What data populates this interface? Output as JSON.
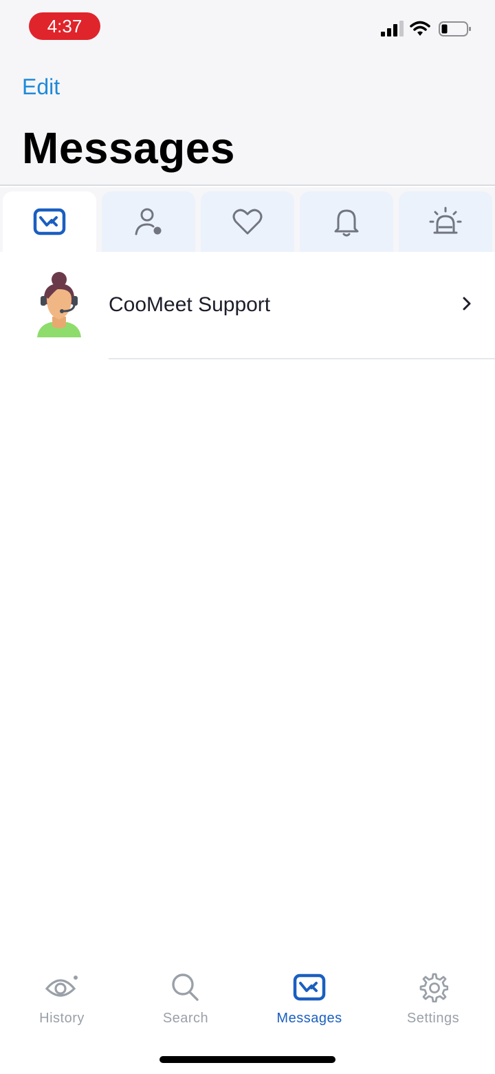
{
  "status_bar": {
    "time": "4:37",
    "icons": [
      "signal-icon",
      "wifi-icon",
      "battery-icon"
    ]
  },
  "header": {
    "edit_label": "Edit",
    "title": "Messages"
  },
  "category_tabs": [
    {
      "icon": "mail-icon",
      "active": true
    },
    {
      "icon": "person-icon",
      "active": false
    },
    {
      "icon": "heart-icon",
      "active": false
    },
    {
      "icon": "bell-icon",
      "active": false
    },
    {
      "icon": "siren-icon",
      "active": false
    }
  ],
  "messages": [
    {
      "name": "CooMeet Support",
      "avatar": "support-agent-avatar"
    }
  ],
  "tab_bar": {
    "items": [
      {
        "label": "History",
        "icon": "eye-icon",
        "active": false
      },
      {
        "label": "Search",
        "icon": "search-icon",
        "active": false
      },
      {
        "label": "Messages",
        "icon": "mail-icon",
        "active": true
      },
      {
        "label": "Settings",
        "icon": "gear-icon",
        "active": false
      }
    ]
  },
  "colors": {
    "accent": "#1a5fc0",
    "link": "#1f8ad9",
    "time_pill": "#e0242b",
    "inactive": "#9aa0a8",
    "tab_bg": "#ecf2fb"
  }
}
